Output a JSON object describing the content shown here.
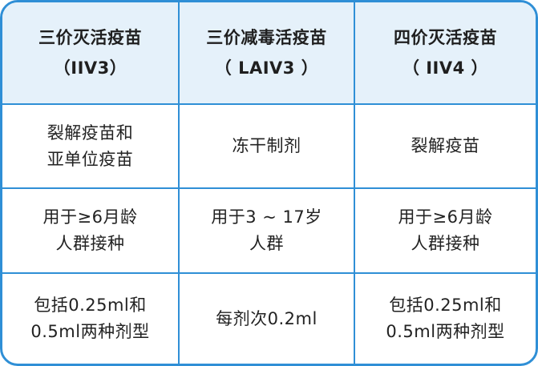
{
  "headers": [
    {
      "name": "三价灭活疫苗",
      "code": "（IIV3）"
    },
    {
      "name": "三价减毒活疫苗",
      "code": "（ LAIV3 ）"
    },
    {
      "name": "四价灭活疫苗",
      "code": "（ IIV4 ）"
    }
  ],
  "rows": [
    [
      [
        "裂解疫苗和",
        "亚单位疫苗"
      ],
      [
        "冻干制剂"
      ],
      [
        "裂解疫苗"
      ]
    ],
    [
      [
        "用于≥6月龄",
        "人群接种"
      ],
      [
        "用于3 ~ 17岁",
        "人群"
      ],
      [
        "用于≥6月龄",
        "人群接种"
      ]
    ],
    [
      [
        "包括0.25ml和",
        "0.5ml两种剂型"
      ],
      [
        "每剂次0.2ml"
      ],
      [
        "包括0.25ml和",
        "0.5ml两种剂型"
      ]
    ]
  ],
  "colors": {
    "border": "#2f8fd6",
    "header_bg": "#e5f1fa"
  }
}
